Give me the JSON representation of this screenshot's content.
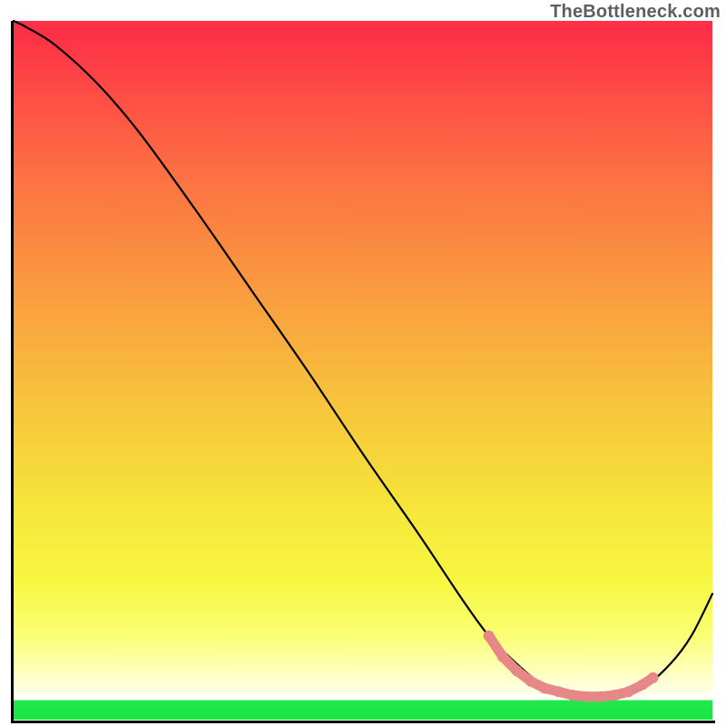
{
  "watermark": "TheBottleneck.com",
  "chart_data": {
    "type": "line",
    "title": "",
    "xlabel": "",
    "ylabel": "",
    "xlim": [
      0,
      100
    ],
    "ylim": [
      0,
      100
    ],
    "legend": false,
    "grid": false,
    "series": [
      {
        "name": "bottleneck-curve",
        "x": [
          0,
          2,
          6,
          12,
          18,
          26,
          34,
          42,
          50,
          58,
          64,
          68,
          72,
          75,
          78,
          82,
          86,
          90,
          94,
          97,
          100
        ],
        "y": [
          100,
          99,
          96.5,
          91,
          84,
          73,
          61.5,
          50,
          38,
          26.5,
          17.5,
          12,
          8,
          5.5,
          4,
          3.3,
          3.3,
          4.5,
          8,
          12,
          18
        ],
        "color": "#000000"
      }
    ],
    "optimal_band": {
      "name": "optimal-range",
      "color": "#e78787",
      "x": [
        68,
        70,
        72,
        74,
        76,
        78,
        80,
        82,
        84,
        86,
        88,
        90,
        91.5
      ],
      "y": [
        12,
        9,
        7,
        5.5,
        4.5,
        4,
        3.5,
        3.3,
        3.3,
        3.5,
        4,
        5,
        6
      ]
    },
    "background_gradient": {
      "top": "#fe2f4a",
      "mid": "#f6e63b",
      "bottom_green": "#17e642"
    }
  }
}
